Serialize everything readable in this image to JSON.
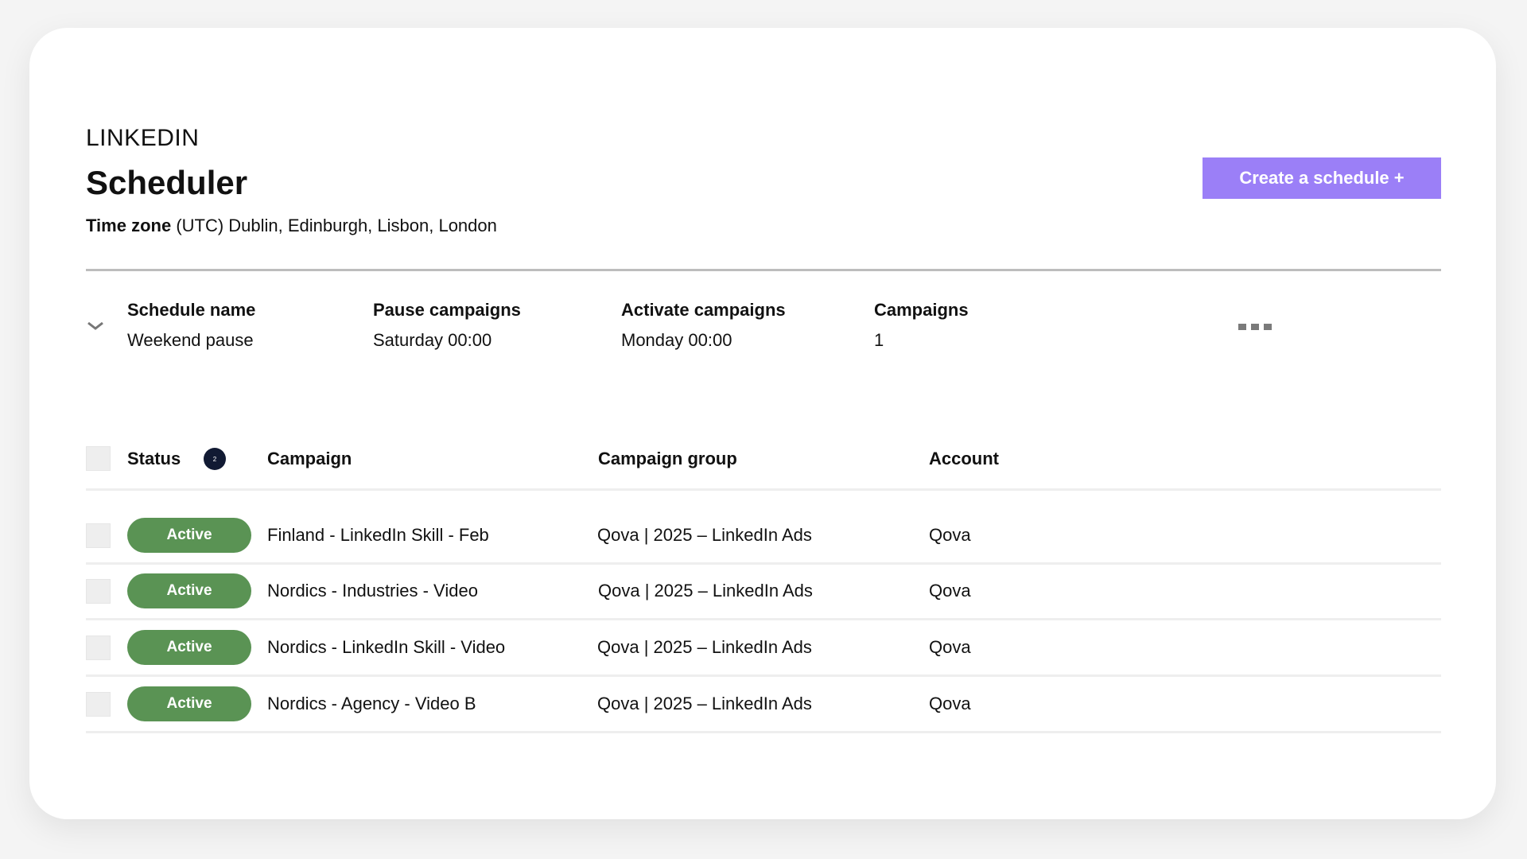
{
  "header": {
    "platform": "LINKEDIN",
    "title": "Scheduler",
    "timezone_label": "Time zone",
    "timezone_value": "(UTC) Dublin, Edinburgh, Lisbon, London",
    "create_button": "Create a schedule +"
  },
  "schedule": {
    "columns": {
      "name": "Schedule name",
      "pause": "Pause campaigns",
      "activate": "Activate campaigns",
      "campaigns": "Campaigns"
    },
    "values": {
      "name": "Weekend pause",
      "pause": "Saturday 00:00",
      "activate": "Monday 00:00",
      "campaigns": "1"
    }
  },
  "table": {
    "headers": {
      "status": "Status",
      "status_count": "2",
      "campaign": "Campaign",
      "campaign_group": "Campaign group",
      "account": "Account"
    },
    "rows": [
      {
        "status": "Active",
        "campaign": "Finland - LinkedIn Skill - Feb",
        "campaign_group": "Qova | 2025 – LinkedIn Ads",
        "account": "Qova"
      },
      {
        "status": "Active",
        "campaign": "Nordics - Industries - Video",
        "campaign_group": "Qova | 2025 – LinkedIn Ads",
        "account": "Qova"
      },
      {
        "status": "Active",
        "campaign": "Nordics - LinkedIn Skill - Video",
        "campaign_group": "Qova | 2025 – LinkedIn Ads",
        "account": "Qova"
      },
      {
        "status": "Active",
        "campaign": "Nordics - Agency - Video B",
        "campaign_group": "Qova | 2025 – LinkedIn Ads",
        "account": "Qova"
      }
    ]
  },
  "icons": {
    "chevron": "chevron-down-icon",
    "more": "more-options-icon"
  },
  "colors": {
    "accent": "#9b7ff7",
    "status_active": "#5a9354",
    "badge": "#111a33"
  }
}
